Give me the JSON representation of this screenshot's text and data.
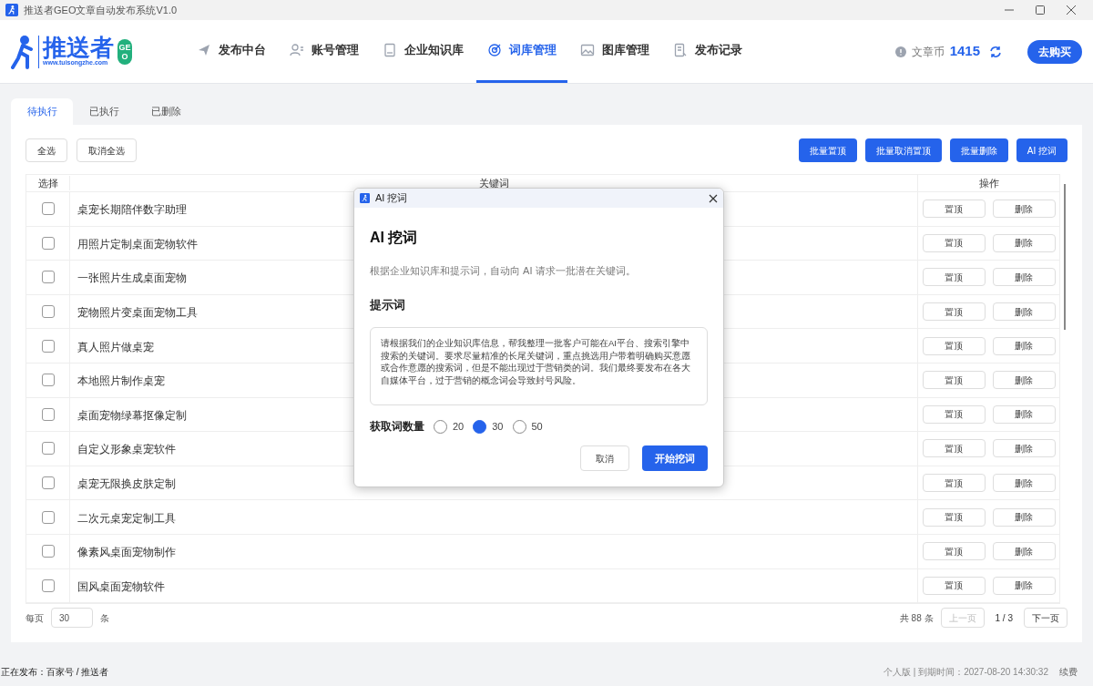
{
  "window": {
    "title": "推送者GEO文章自动发布系统V1.0"
  },
  "logo": {
    "name": "推送者",
    "url": "www.tuisongzhe.com",
    "badge": "GEO"
  },
  "nav": [
    {
      "label": "发布中台",
      "selected": false
    },
    {
      "label": "账号管理",
      "selected": false
    },
    {
      "label": "企业知识库",
      "selected": false
    },
    {
      "label": "词库管理",
      "selected": true
    },
    {
      "label": "图库管理",
      "selected": false
    },
    {
      "label": "发布记录",
      "selected": false
    }
  ],
  "coins": {
    "label": "文章币",
    "value": "1415"
  },
  "buy_button": "去购买",
  "tabs": [
    {
      "label": "待执行",
      "selected": true
    },
    {
      "label": "已执行",
      "selected": false
    },
    {
      "label": "已删除",
      "selected": false
    }
  ],
  "left_actions": [
    "全选",
    "取消全选"
  ],
  "right_actions": [
    "批量置顶",
    "批量取消置顶",
    "批量删除",
    "AI 挖词"
  ],
  "table": {
    "columns": [
      "选择",
      "关键词",
      "操作"
    ],
    "rows": [
      {
        "keyword": "桌宠长期陪伴数字助理",
        "checked": false,
        "actions": [
          "置顶",
          "删除"
        ]
      },
      {
        "keyword": "用照片定制桌面宠物软件",
        "checked": false,
        "actions": [
          "置顶",
          "删除"
        ]
      },
      {
        "keyword": "一张照片生成桌面宠物",
        "checked": false,
        "actions": [
          "置顶",
          "删除"
        ]
      },
      {
        "keyword": "宠物照片变桌面宠物工具",
        "checked": false,
        "actions": [
          "置顶",
          "删除"
        ]
      },
      {
        "keyword": "真人照片做桌宠",
        "checked": false,
        "actions": [
          "置顶",
          "删除"
        ]
      },
      {
        "keyword": "本地照片制作桌宠",
        "checked": false,
        "actions": [
          "置顶",
          "删除"
        ]
      },
      {
        "keyword": "桌面宠物绿幕抠像定制",
        "checked": false,
        "actions": [
          "置顶",
          "删除"
        ]
      },
      {
        "keyword": "自定义形象桌宠软件",
        "checked": false,
        "actions": [
          "置顶",
          "删除"
        ]
      },
      {
        "keyword": "桌宠无限换皮肤定制",
        "checked": false,
        "actions": [
          "置顶",
          "删除"
        ]
      },
      {
        "keyword": "二次元桌宠定制工具",
        "checked": false,
        "actions": [
          "置顶",
          "删除"
        ]
      },
      {
        "keyword": "像素风桌面宠物制作",
        "checked": false,
        "actions": [
          "置顶",
          "删除"
        ]
      },
      {
        "keyword": "国风桌面宠物软件",
        "checked": false,
        "actions": [
          "置顶",
          "删除"
        ]
      }
    ]
  },
  "pagination": {
    "per_page_label": "每页",
    "per_page": "30",
    "unit": "条",
    "total": "共 88 条",
    "prev": "上一页",
    "page": "1 / 3",
    "next": "下一页"
  },
  "status_bar": {
    "publishing": "正在发布：百家号 / 推送者",
    "edition": "个人版 | 到期时间：2027-08-20 14:30:32",
    "renew": "续费"
  },
  "dialog": {
    "title": "AI 挖词",
    "heading": "AI 挖词",
    "description": "根据企业知识库和提示词，自动向 AI 请求一批潜在关键词。",
    "prompt_label": "提示词",
    "prompt": "请根据我们的企业知识库信息，帮我整理一批客户可能在AI平台、搜索引擎中搜索的关键词。要求尽量精准的长尾关键词，重点挑选用户带着明确购买意愿或合作意愿的搜索词，但是不能出现过于营销类的词。我们最终要发布在各大自媒体平台，过于营销的概念词会导致封号风险。",
    "count_label": "获取词数量",
    "counts": [
      {
        "label": "20",
        "selected": false
      },
      {
        "label": "30",
        "selected": true
      },
      {
        "label": "50",
        "selected": false
      }
    ],
    "cancel": "取消",
    "confirm": "开始挖词"
  }
}
